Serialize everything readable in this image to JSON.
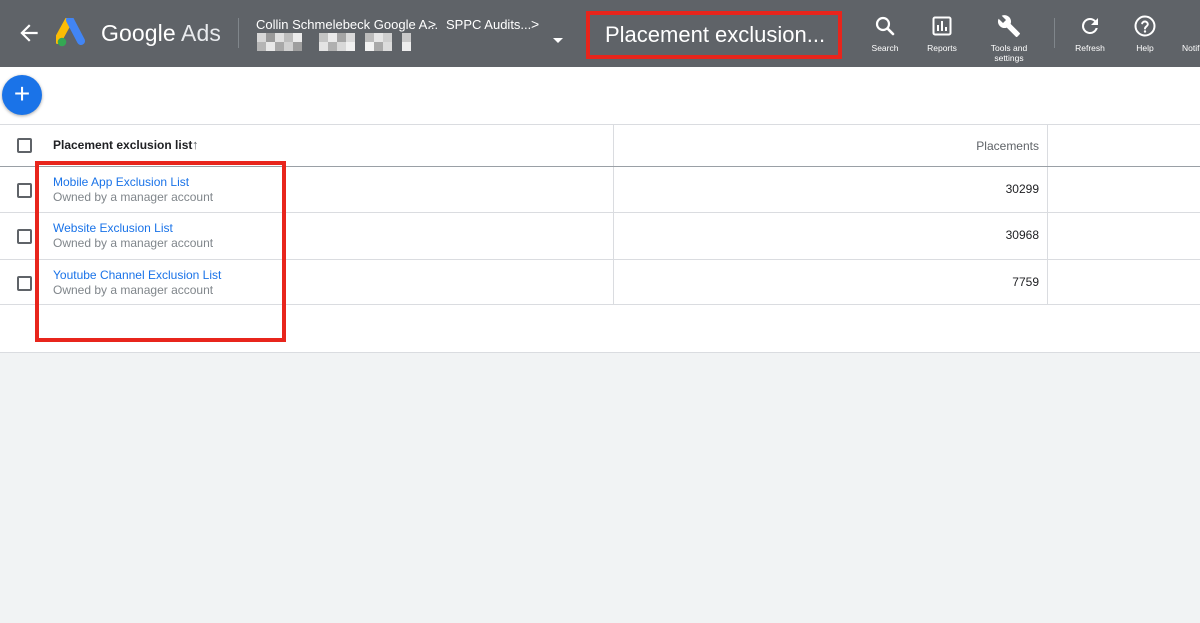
{
  "app": {
    "brand_google": "Google",
    "brand_ads": "Ads"
  },
  "breadcrumb": {
    "account": "Collin Schmelebeck Google A...",
    "sub_account": "SPPC Audits...",
    "chevron": ">"
  },
  "header": {
    "page_title": "Placement exclusion..."
  },
  "toolbar": {
    "search_label": "Search",
    "reports_label": "Reports",
    "tools_label_line1": "Tools and",
    "tools_label_line2": "settings",
    "refresh_label": "Refresh",
    "help_label": "Help",
    "notifications_label": "Notifi"
  },
  "fab": {
    "label": "+"
  },
  "table": {
    "col_name": "Placement exclusion list",
    "col_placements": "Placements",
    "sort_arrow": "↑",
    "rows": [
      {
        "name": "Mobile App Exclusion List",
        "owner": "Owned by a manager account",
        "placements": "30299"
      },
      {
        "name": "Website Exclusion List",
        "owner": "Owned by a manager account",
        "placements": "30968"
      },
      {
        "name": "Youtube Channel Exclusion List",
        "owner": "Owned by a manager account",
        "placements": "7759"
      }
    ]
  },
  "colors": {
    "topbar": "#5f6368",
    "accent_blue": "#1a73e8",
    "highlight_red": "#e8251c"
  }
}
